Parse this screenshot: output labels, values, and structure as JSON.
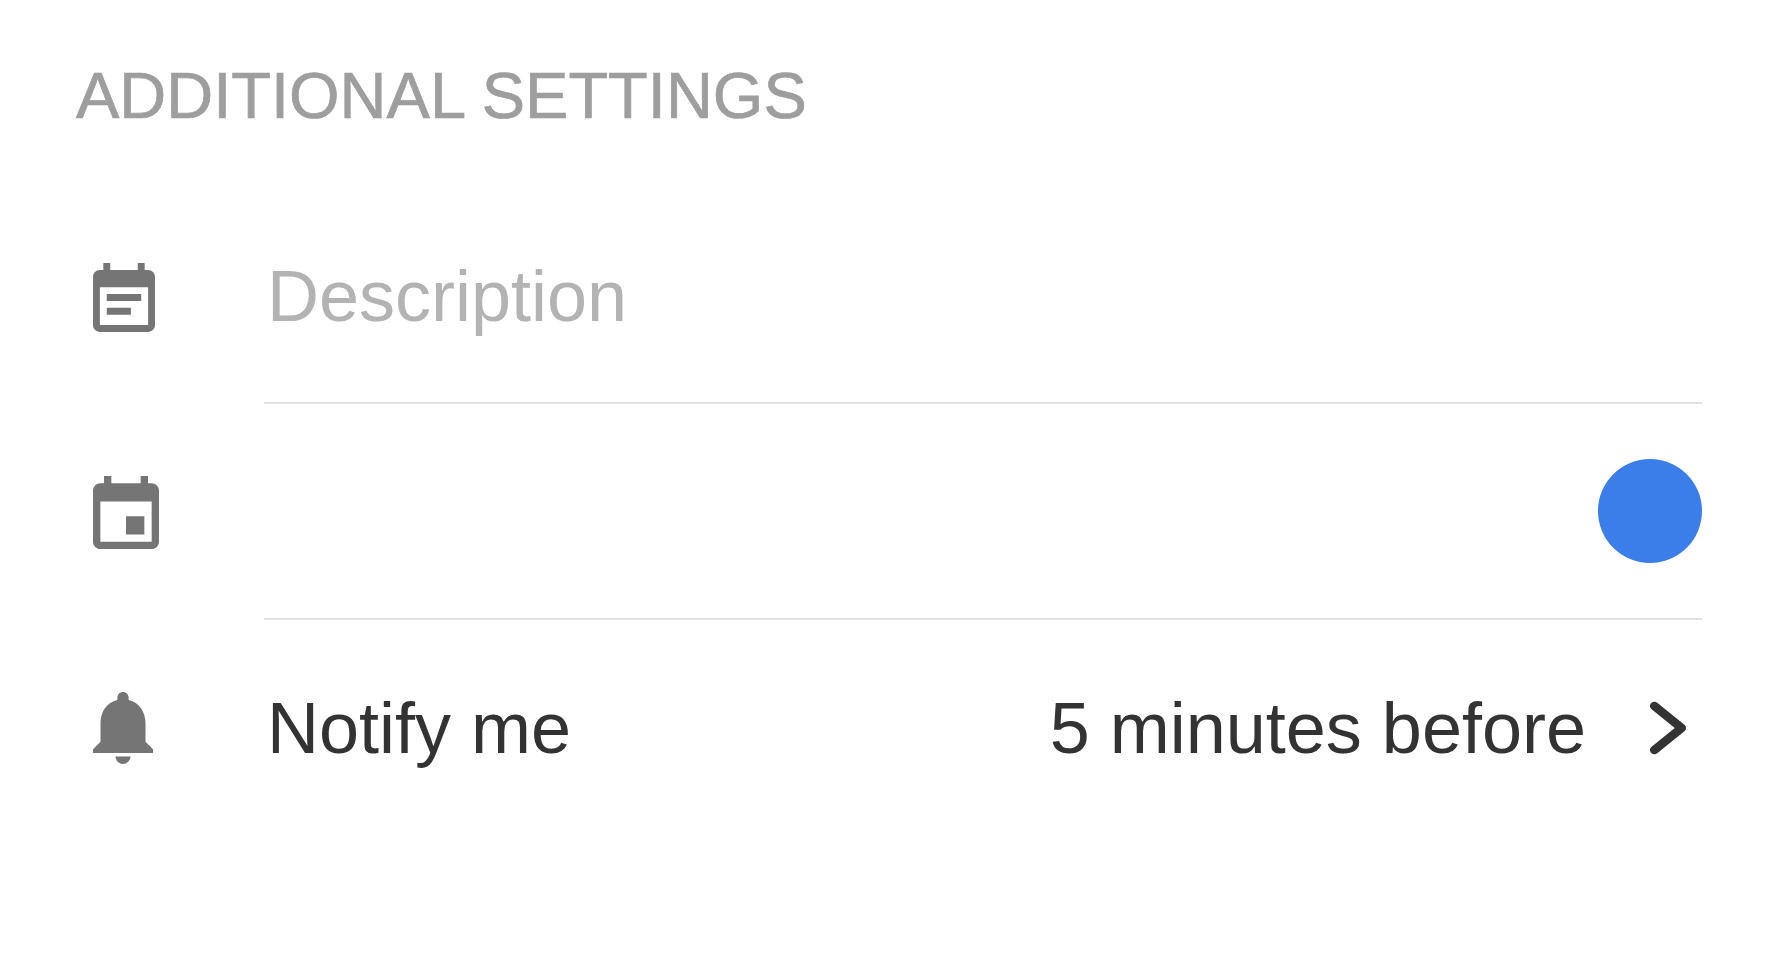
{
  "section_title": "ADDITIONAL SETTINGS",
  "rows": [
    {
      "kind": "field",
      "placeholder": "Description"
    },
    {
      "kind": "color",
      "color": "#3b7de9"
    },
    {
      "kind": "option",
      "label": "Notify me",
      "value": "5 minutes before"
    }
  ]
}
